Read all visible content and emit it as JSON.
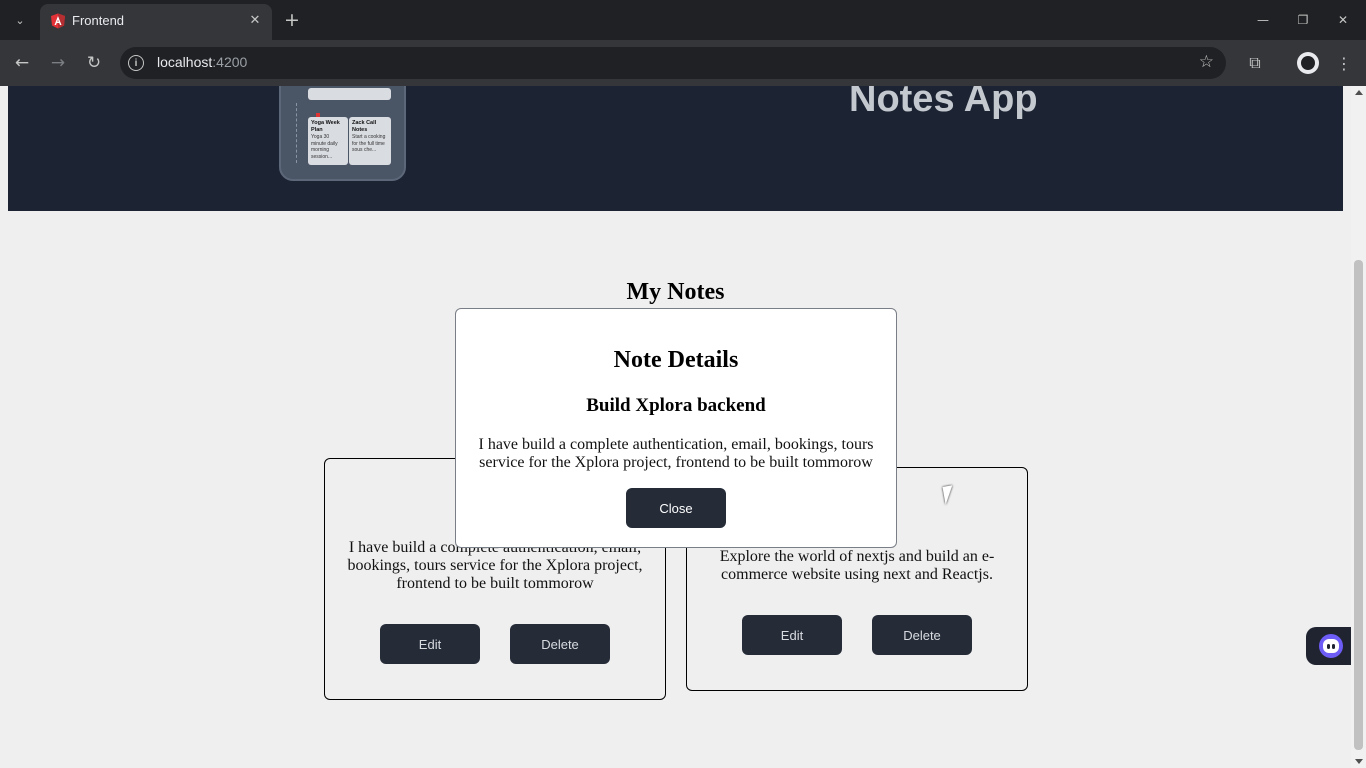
{
  "browser": {
    "tab": {
      "title": "Frontend",
      "favicon": "angular-icon"
    },
    "url": {
      "host": "localhost",
      "port": ":4200"
    },
    "icons": {
      "tab_list": "chevron-down-icon",
      "tab_close": "close-icon",
      "new_tab": "plus-icon",
      "minimize": "minimize-icon",
      "restore": "restore-icon",
      "close_window": "close-icon",
      "back": "arrow-left-icon",
      "forward": "arrow-right-icon",
      "reload": "reload-icon",
      "site_info": "info-icon",
      "bookmark": "star-icon",
      "extensions": "puzzle-icon",
      "profile": "avatar-icon",
      "menu": "kebab-menu-icon"
    },
    "glyphs": {
      "tab_list": "⌄",
      "tab_close": "✕",
      "new_tab": "+",
      "minimize": "—",
      "restore": "❐",
      "close_window": "✕",
      "back": "←",
      "forward": "→",
      "reload": "↻",
      "site_info": "i",
      "bookmark": "☆",
      "extensions": "⧉",
      "menu": "⋮"
    }
  },
  "hero": {
    "title": "Notes App",
    "phone_cards": [
      {
        "title": "Yoga Week Plan",
        "text": "Yoga 30 minute daily morning session..."
      },
      {
        "title": "Zack Call Notes",
        "text": "Start a cooking for the full time sous che..."
      }
    ]
  },
  "main": {
    "title": "My Notes",
    "notes": [
      {
        "title": "Build",
        "body": "I have build a complete authentication, email, bookings, tours service for the Xplora project, frontend to be built tommorow",
        "edit_label": "Edit",
        "delete_label": "Delete"
      },
      {
        "title": "",
        "body": "Explore the world of nextjs and build an e-commerce website using next and Reactjs.",
        "edit_label": "Edit",
        "delete_label": "Delete"
      }
    ]
  },
  "modal": {
    "heading": "Note Details",
    "title": "Build Xplora backend",
    "body": "I have build a complete authentication, email, bookings, tours service for the Xplora project, frontend to be built tommorow",
    "close_label": "Close"
  },
  "widgets": {
    "chat_icon": "chatbot-icon"
  },
  "colors": {
    "hero_bg": "#1c2433",
    "button_bg": "#252c38",
    "page_bg": "#efefef",
    "chrome_dark": "#202124",
    "chrome_toolbar": "#35363a",
    "chat_accent": "#6d5cf6"
  }
}
